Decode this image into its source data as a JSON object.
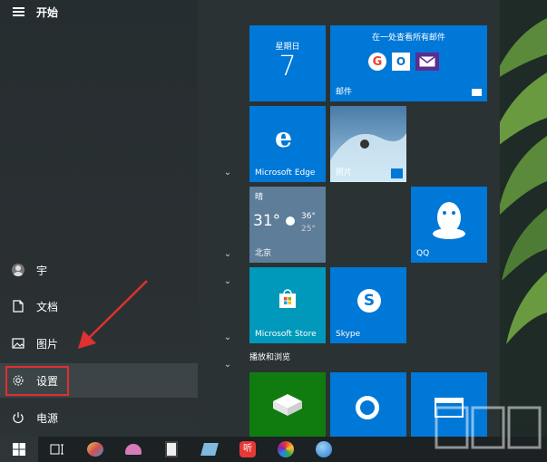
{
  "start_menu": {
    "title": "开始",
    "items": [
      {
        "label": "宇",
        "icon": "user-avatar-icon"
      },
      {
        "label": "文档",
        "icon": "document-icon"
      },
      {
        "label": "图片",
        "icon": "pictures-icon"
      },
      {
        "label": "设置",
        "icon": "gear-icon"
      },
      {
        "label": "电源",
        "icon": "power-icon"
      }
    ]
  },
  "tiles": {
    "calendar": {
      "day_name": "星期日",
      "day_number": "7"
    },
    "mail": {
      "headline": "在一处查看所有邮件",
      "label": "邮件"
    },
    "edge": {
      "label": "Microsoft Edge"
    },
    "photos": {
      "label": "照片"
    },
    "weather": {
      "condition": "晴",
      "temp": "31°",
      "high": "36°",
      "low": "25°",
      "city": "北京"
    },
    "qq": {
      "label": "QQ"
    },
    "store": {
      "label": "Microsoft Store"
    },
    "skype": {
      "label": "Skype"
    },
    "section_label": "播放和浏览"
  },
  "colors": {
    "tile_blue": "#0078d7",
    "highlight_red": "#e03030",
    "green_tile": "#107c10"
  },
  "watermark": "下载吧"
}
